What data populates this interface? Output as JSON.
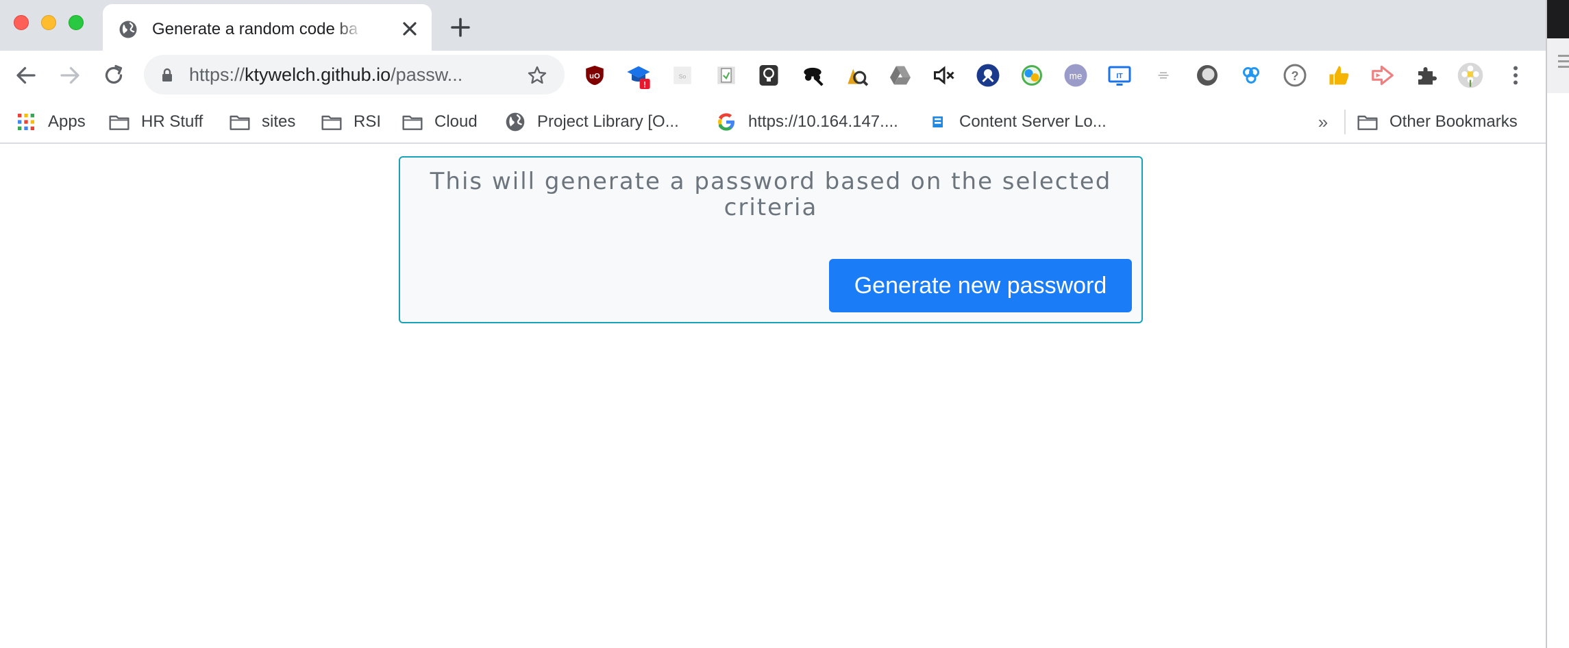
{
  "browser": {
    "tab": {
      "title": "Generate a random code based on selected criteria",
      "favicon": "globe-icon"
    },
    "omnibox": {
      "url_scheme": "https://",
      "url_host": "ktywelch.github.io",
      "url_path": "/passw..."
    },
    "extensions": [
      {
        "name": "ublock-icon",
        "color": "#800000"
      },
      {
        "name": "graduation-cap-icon",
        "color": "#1a73e8",
        "badge": "!"
      },
      {
        "name": "grey-square-icon",
        "color": "#cccccc"
      },
      {
        "name": "document-icon",
        "color": "#8a8a8a"
      },
      {
        "name": "lightbulb-icon",
        "color": "#333333"
      },
      {
        "name": "spy-icon",
        "color": "#111111"
      },
      {
        "name": "magnifier-icon",
        "color": "#c8860a"
      },
      {
        "name": "google-drive-icon",
        "color": "#777777"
      },
      {
        "name": "mute-icon",
        "color": "#222222"
      },
      {
        "name": "robot-icon",
        "color": "#1b3a8c"
      },
      {
        "name": "chrome-remote-icon",
        "color": "#4caf50"
      },
      {
        "name": "me-icon",
        "color": "#9b9bc9"
      },
      {
        "name": "it-icon",
        "color": "#1a73e8"
      },
      {
        "name": "bars-icon",
        "color": "#999999"
      },
      {
        "name": "circle-icon",
        "color": "#555555"
      },
      {
        "name": "flower-icon",
        "color": "#2196f3"
      },
      {
        "name": "help-icon",
        "color": "#777777"
      },
      {
        "name": "thumbs-up-icon",
        "color": "#f4b400"
      },
      {
        "name": "arrow-icon",
        "color": "#f08080"
      },
      {
        "name": "puzzle-icon",
        "color": "#444444"
      },
      {
        "name": "profile-avatar-icon",
        "color": "#cfcfcf"
      }
    ]
  },
  "bookmarks": [
    {
      "label": "Apps",
      "icon": "apps-grid-icon"
    },
    {
      "label": "HR Stuff",
      "icon": "folder-icon"
    },
    {
      "label": "sites",
      "icon": "folder-icon"
    },
    {
      "label": "RSI",
      "icon": "folder-icon"
    },
    {
      "label": "Cloud",
      "icon": "folder-icon"
    },
    {
      "label": "Project Library [O...",
      "icon": "globe-icon"
    },
    {
      "label": "https://10.164.147....",
      "icon": "google-icon"
    },
    {
      "label": "Content Server Lo...",
      "icon": "server-icon"
    }
  ],
  "bookmarks_more": "»",
  "other_bookmarks": "Other Bookmarks",
  "page": {
    "headline": "This will generate a password based on the selected criteria",
    "generate_button": "Generate new password"
  }
}
